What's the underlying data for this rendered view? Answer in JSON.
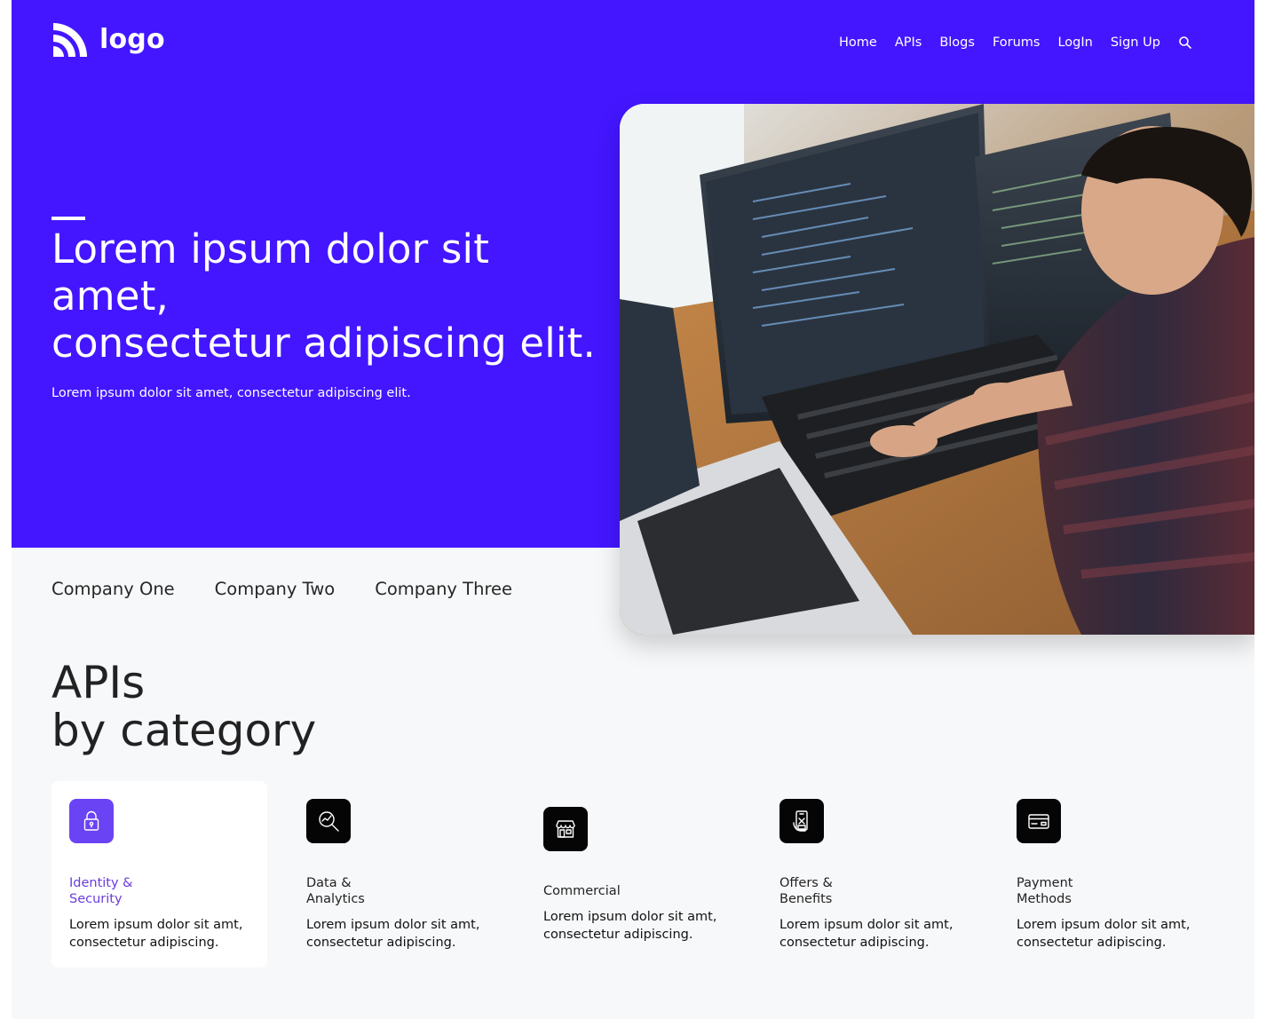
{
  "brand": {
    "logo_text": "logo",
    "accent": "#4316ff",
    "highlight": "#6a43f4"
  },
  "nav": {
    "items": [
      "Home",
      "APIs",
      "Blogs",
      "Forums",
      "LogIn",
      "Sign Up"
    ],
    "search_icon": "search-icon"
  },
  "hero": {
    "title_line1": "Lorem ipsum dolor sit",
    "title_line2": "amet,",
    "title_line3": "consectetur adipiscing elit.",
    "subtitle": "Lorem ipsum dolor sit amet, consectetur adipiscing elit.",
    "image": "developer-at-workstation-photo"
  },
  "companies": [
    "Company One",
    "Company Two",
    "Company Three"
  ],
  "apis": {
    "heading_line1": "APIs",
    "heading_line2": "by category"
  },
  "categories": [
    {
      "title": "Identity & Security",
      "description": "Lorem ipsum dolor sit amt, consectetur adipiscing.",
      "icon": "lock-icon",
      "active": true
    },
    {
      "title": "Data & Analytics",
      "description": "Lorem ipsum dolor sit amt, consectetur adipiscing.",
      "icon": "analytics-search-icon",
      "active": false
    },
    {
      "title": "Commercial",
      "description": "Lorem ipsum dolor sit amt, consectetur adipiscing.",
      "icon": "storefront-icon",
      "active": false
    },
    {
      "title": "Offers & Benefits",
      "description": "Lorem ipsum dolor sit amt, consectetur adipiscing.",
      "icon": "mobile-offer-icon",
      "active": false
    },
    {
      "title": "Payment Methods",
      "description": "Lorem ipsum dolor sit amt, consectetur adipiscing.",
      "icon": "credit-card-icon",
      "active": false
    }
  ]
}
